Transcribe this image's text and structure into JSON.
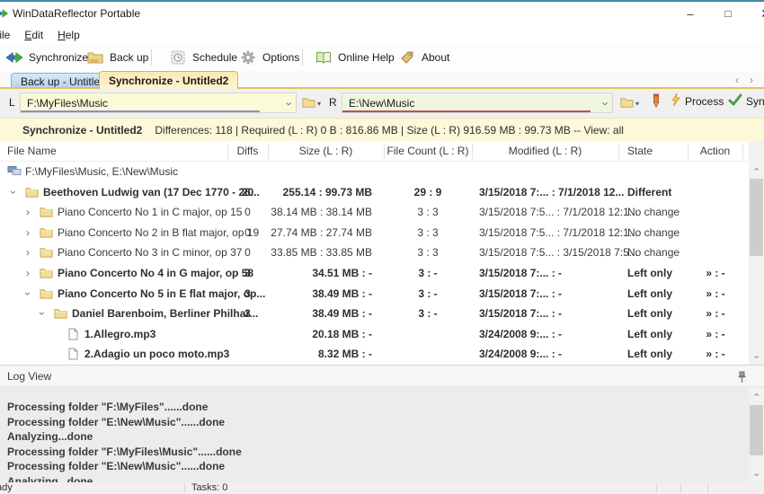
{
  "window": {
    "title": "WinDataReflector Portable",
    "controls": {
      "minimize": "–",
      "maximize": "□",
      "close": "✕"
    }
  },
  "menu": {
    "items": [
      "File",
      "Edit",
      "Help"
    ]
  },
  "toolbar": {
    "buttons": [
      {
        "id": "synchronize",
        "label": "Synchronize"
      },
      {
        "id": "backup",
        "label": "Back up"
      },
      {
        "id": "schedule",
        "label": "Schedule"
      },
      {
        "id": "options",
        "label": "Options"
      },
      {
        "id": "online-help",
        "label": "Online Help"
      },
      {
        "id": "about",
        "label": "About"
      }
    ]
  },
  "tabs": [
    {
      "label": "Back up - Untitled",
      "active": false
    },
    {
      "label": "Synchronize - Untitled2",
      "active": true
    }
  ],
  "paths": {
    "left_label": "L",
    "left_value": "F:\\MyFiles\\Music",
    "right_label": "R",
    "right_value": "E:\\New\\Music",
    "process_label": "Process",
    "sync_label": "Synchronize"
  },
  "info_bar": {
    "title": "Synchronize - Untitled2",
    "details": "Differences: 118  |  Required (L : R)   0 B : 816.86 MB  |  Size (L : R)   916.59 MB : 99.73 MB -- View: all"
  },
  "table": {
    "columns": [
      "File Name",
      "Diffs",
      "Size (L : R)",
      "File Count (L : R)",
      "Modified (L : R)",
      "State",
      "Action"
    ],
    "rows": [
      {
        "name": "F:\\MyFiles\\Music, E:\\New\\Music",
        "level": 0,
        "icon": "root",
        "expander": "none",
        "bold": false,
        "diffs": "",
        "size": "",
        "count": "",
        "modified": "",
        "state": "",
        "action": ""
      },
      {
        "name": "Beethoven Ludwig van (17 Dec 1770 - 26...",
        "level": 1,
        "icon": "folder",
        "expander": "down",
        "bold": true,
        "diffs": "20",
        "size": "255.14 : 99.73 MB",
        "count": "29 : 9",
        "modified": "3/15/2018 7:... : 7/1/2018 12...",
        "state": "Different",
        "action": ""
      },
      {
        "name": "Piano Concerto No 1 in C major, op 15",
        "level": 2,
        "icon": "folder",
        "expander": "right",
        "bold": false,
        "diffs": "0",
        "size": "38.14 MB : 38.14 MB",
        "count": "3 : 3",
        "modified": "3/15/2018 7:5... : 7/1/2018 12:1...",
        "state": "No change",
        "action": ""
      },
      {
        "name": "Piano Concerto No 2 in B flat major, op 19",
        "level": 2,
        "icon": "folder",
        "expander": "right",
        "bold": false,
        "diffs": "0",
        "size": "27.74 MB : 27.74 MB",
        "count": "3 : 3",
        "modified": "3/15/2018 7:5... : 7/1/2018 12:1...",
        "state": "No change",
        "action": ""
      },
      {
        "name": "Piano Concerto No 3 in C minor, op 37",
        "level": 2,
        "icon": "folder",
        "expander": "right",
        "bold": false,
        "diffs": "0",
        "size": "33.85 MB : 33.85 MB",
        "count": "3 : 3",
        "modified": "3/15/2018 7:5... : 3/15/2018 7:5...",
        "state": "No change",
        "action": ""
      },
      {
        "name": "Piano Concerto No 4 in G major, op 58",
        "level": 2,
        "icon": "folder",
        "expander": "right",
        "bold": true,
        "diffs": "3",
        "size": "34.51 MB : -",
        "count": "3 : -",
        "modified": "3/15/2018 7:... : -",
        "state": "Left only",
        "action": "» : -"
      },
      {
        "name": "Piano Concerto No 5 in E flat major, op...",
        "level": 2,
        "icon": "folder",
        "expander": "down",
        "bold": true,
        "diffs": "3",
        "size": "38.49 MB : -",
        "count": "3 : -",
        "modified": "3/15/2018 7:... : -",
        "state": "Left only",
        "action": "» : -"
      },
      {
        "name": "Daniel Barenboim, Berliner Philhar...",
        "level": 3,
        "icon": "folder",
        "expander": "down",
        "bold": true,
        "diffs": "3",
        "size": "38.49 MB : -",
        "count": "3 : -",
        "modified": "3/15/2018 7:... : -",
        "state": "Left only",
        "action": "» : -"
      },
      {
        "name": "1.Allegro.mp3",
        "level": 4,
        "icon": "file",
        "expander": "none",
        "bold": true,
        "diffs": "",
        "size": "20.18 MB : -",
        "count": "",
        "modified": "3/24/2008 9:... : -",
        "state": "Left only",
        "action": "» : -"
      },
      {
        "name": "2.Adagio un poco moto.mp3",
        "level": 4,
        "icon": "file",
        "expander": "none",
        "bold": true,
        "diffs": "",
        "size": "8.32 MB : -",
        "count": "",
        "modified": "3/24/2008 9:... : -",
        "state": "Left only",
        "action": "» : -"
      }
    ]
  },
  "log": {
    "header": "Log View",
    "lines": [
      "Processing folder \"F:\\MyFiles\"......done",
      "Processing folder \"E:\\New\\Music\"......done",
      "Analyzing...done",
      "Processing folder \"F:\\MyFiles\\Music\"......done",
      "Processing folder \"E:\\New\\Music\"......done",
      "Analyzing...done"
    ]
  },
  "status_bar": {
    "ready": "Ready",
    "tasks": "Tasks: 0"
  },
  "colors": {
    "window_border": "#3e89a9",
    "active_tab_bg": "#fdf3d2",
    "info_bar_bg": "#fdf8da",
    "left_path_underline": "#8f8fc4",
    "right_path_underline": "#c0504d",
    "folder_icon": "#f2de96",
    "check_icon": "#44a044",
    "lightning_icon": "#f7c84b"
  }
}
